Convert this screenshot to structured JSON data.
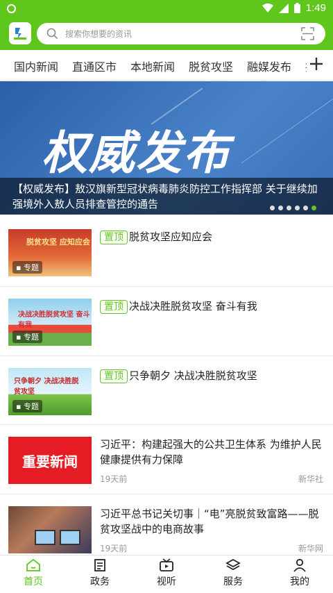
{
  "status": {
    "time": "1:49"
  },
  "search": {
    "placeholder": "搜索你想要的资讯"
  },
  "tabs": [
    "国内新闻",
    "直通区市",
    "本地新闻",
    "脱贫攻坚",
    "融媒发布",
    "扫"
  ],
  "banner": {
    "headline": "权威发布",
    "caption": "【权威发布】敖汉旗新型冠状病毒肺炎防控工作指挥部 关于继续加强境外入敖人员排查管控的通告",
    "dots": 6,
    "active_dot": 6
  },
  "pin_label": "置顶",
  "topic_badge": "专题",
  "news": [
    {
      "title": "脱贫攻坚应知应会",
      "pinned": true,
      "thumb_text": "脱贫攻坚 应知应会"
    },
    {
      "title": "决战决胜脱贫攻坚  奋斗有我",
      "pinned": true,
      "thumb_text": "决战决胜脱贫攻坚 奋斗有我"
    },
    {
      "title": "只争朝夕  决战决胜脱贫攻坚",
      "pinned": true,
      "thumb_text": "只争朝夕 决战决胜脱贫攻坚"
    },
    {
      "title": "习近平：构建起强大的公共卫生体系 为维护人民健康提供有力保障",
      "time": "19天前",
      "source": "新华社",
      "thumb_text": "重要新闻"
    },
    {
      "title": "习近平总书记关切事｜“电”亮脱贫致富路——脱贫攻坚战中的电商故事",
      "time": "19天前",
      "source": "新华网"
    }
  ],
  "nav": [
    "首页",
    "政务",
    "视听",
    "服务",
    "我的"
  ],
  "colors": {
    "accent": "#5fc71c",
    "banner": "#2b5fa8",
    "red": "#e51c23"
  }
}
